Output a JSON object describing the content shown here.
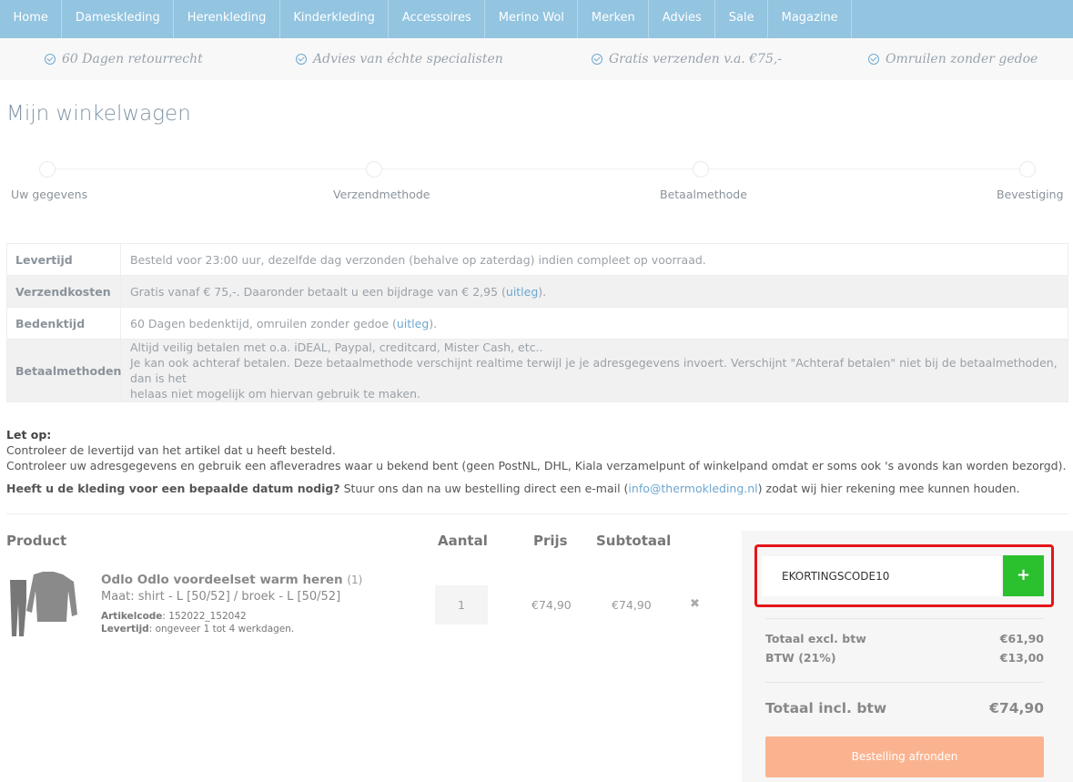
{
  "nav": {
    "items": [
      "Home",
      "Dameskleding",
      "Herenkleding",
      "Kinderkleding",
      "Accessoires",
      "Merino Wol",
      "Merken",
      "Advies",
      "Sale",
      "Magazine"
    ]
  },
  "usps": [
    "60 Dagen retourrecht",
    "Advies van échte specialisten",
    "Gratis verzenden v.a. €75,-",
    "Omruilen zonder gedoe"
  ],
  "page_title": "Mijn winkelwagen",
  "steps": [
    "Uw gegevens",
    "Verzendmethode",
    "Betaalmethode",
    "Bevestiging"
  ],
  "info": {
    "levertijd_key": "Levertijd",
    "levertijd_val": "Besteld voor 23:00 uur, dezelfde dag verzonden (behalve op zaterdag) indien compleet op voorraad.",
    "verzend_key": "Verzendkosten",
    "verzend_val": "Gratis vanaf € 75,-. Daaronder betaalt u een bijdrage van € 2,95 (",
    "verzend_link": "uitleg",
    "verzend_end": ").",
    "bedenk_key": "Bedenktijd",
    "bedenk_val": "60 Dagen bedenktijd, omruilen zonder gedoe (",
    "bedenk_link": "uitleg",
    "bedenk_end": ").",
    "betaal_key": "Betaalmethoden",
    "betaal_line1": "Altijd veilig betalen met o.a. iDEAL, Paypal, creditcard, Mister Cash, etc..",
    "betaal_line2": "Je kan ook achteraf betalen. Deze betaalmethode verschijnt realtime terwijl je je adresgegevens invoert. Verschijnt \"Achteraf betalen\" niet bij de betaalmethoden, dan is het",
    "betaal_line3": "helaas niet mogelijk om hiervan gebruik te maken."
  },
  "notes": {
    "heading": "Let op:",
    "line1": "Controleer de levertijd van het artikel dat u heeft besteld.",
    "line2": "Controleer uw adresgegevens en gebruik een afleveradres waar u bekend bent (geen PostNL, DHL, Kiala verzamelpunt of winkelpand omdat er soms ook 's avonds kan worden bezorgd).",
    "question": "Heeft u de kleding voor een bepaalde datum nodig?",
    "question_rest": " Stuur ons dan na uw bestelling direct een e-mail (",
    "email": "info@thermokleding.nl",
    "question_end": ") zodat wij hier rekening mee kunnen houden."
  },
  "table": {
    "col_product": "Product",
    "col_qty": "Aantal",
    "col_price": "Prijs",
    "col_subtotal": "Subtotaal"
  },
  "product": {
    "name": "Odlo Odlo voordeelset warm heren",
    "count": "(1)",
    "size": "Maat: shirt - L [50/52] / broek - L [50/52]",
    "code_label": "Artikelcode",
    "code": ": 152022_152042",
    "lt_label": "Levertijd",
    "lt": ": ongeveer 1 tot 4 werkdagen.",
    "qty": "1",
    "price": "€74,90",
    "subtotal": "€74,90",
    "remove": "✖"
  },
  "summary": {
    "coupon_value": "EKORTINGSCODE10",
    "coupon_btn": "+",
    "excl_label": "Totaal excl. btw",
    "excl_value": "€61,90",
    "btw_label": "BTW (21%)",
    "btw_value": "€13,00",
    "total_label": "Totaal incl. btw",
    "total_value": "€74,90",
    "checkout": "Bestelling afronden"
  },
  "colors": {
    "nav_bg": "#93c4e0",
    "coupon_btn": "#2bc02e",
    "checkout_btn": "#fbb38f",
    "highlight": "#e4151a"
  }
}
